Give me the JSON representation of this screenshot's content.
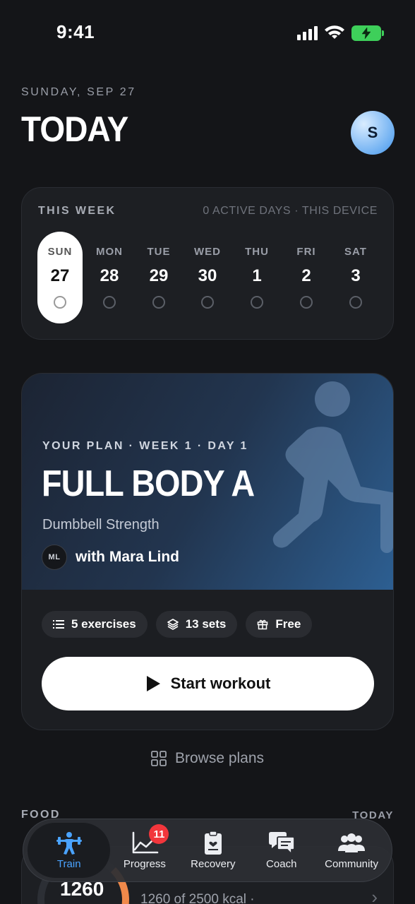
{
  "status_bar": {
    "time": "9:41"
  },
  "header": {
    "date": "SUNDAY, SEP 27",
    "title": "TODAY",
    "avatar_initial": "S"
  },
  "week": {
    "title": "THIS WEEK",
    "meta": "0 ACTIVE DAYS · THIS DEVICE",
    "days": [
      {
        "name": "SUN",
        "num": "27",
        "active": true
      },
      {
        "name": "MON",
        "num": "28"
      },
      {
        "name": "TUE",
        "num": "29"
      },
      {
        "name": "WED",
        "num": "30"
      },
      {
        "name": "THU",
        "num": "1"
      },
      {
        "name": "FRI",
        "num": "2"
      },
      {
        "name": "SAT",
        "num": "3"
      }
    ]
  },
  "plan": {
    "eyebrow": "YOUR PLAN · WEEK 1 · DAY 1",
    "name": "FULL BODY A",
    "subtitle": "Dumbbell Strength",
    "coach_initials": "ML",
    "coach": "with Mara Lind",
    "chips": [
      {
        "icon": "list-icon",
        "label": "5 exercises"
      },
      {
        "icon": "layers-icon",
        "label": "13 sets"
      },
      {
        "icon": "gift-icon",
        "label": "Free"
      }
    ],
    "start_label": "Start workout"
  },
  "browse_label": "Browse plans",
  "food": {
    "label": "FOOD",
    "today": "TODAY",
    "kcal": "1260",
    "detail": "1260 of 2500 kcal ·"
  },
  "tabs": [
    {
      "label": "Train",
      "icon": "barbell-icon",
      "active": true
    },
    {
      "label": "Progress",
      "icon": "chart-icon",
      "badge": "11"
    },
    {
      "label": "Recovery",
      "icon": "clipboard-heart-icon"
    },
    {
      "label": "Coach",
      "icon": "chat-bubbles-icon"
    },
    {
      "label": "Community",
      "icon": "people-icon"
    }
  ],
  "colors": {
    "accent": "#4aa3ff",
    "badge": "#f2363c",
    "battery": "#3ecf5a",
    "food_ring": "#f0894a"
  }
}
